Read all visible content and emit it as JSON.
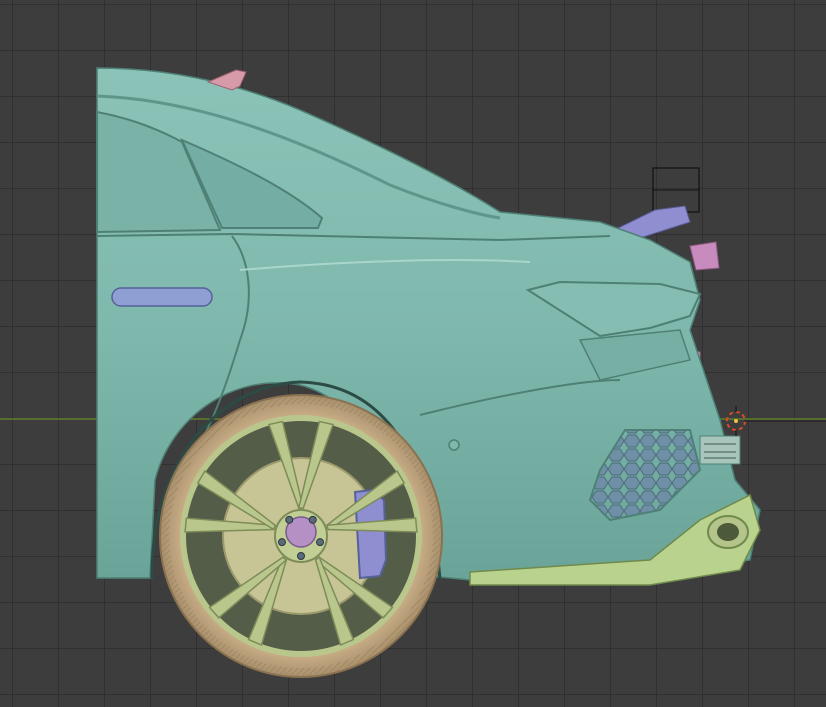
{
  "viewport": {
    "grid_color": "#303030",
    "background_color": "#3d3d3d",
    "x_axis_color": "#6b8f2a"
  },
  "colors": {
    "body": "#7fb8ad",
    "body_shadow": "#5f968c",
    "body_highlight": "#a9d6cc",
    "window": "#74ada3",
    "tire": "#c8ad86",
    "tire_dark": "#a8906c",
    "rim": "#b9c78d",
    "disc": "#c7c496",
    "hub": "#b490c4",
    "caliper": "#8f8ed0",
    "exhaust_tip": "#c88bbd",
    "antenna": "#d79aa8",
    "honeycomb": "#6f8fa6",
    "origin_red": "#d94a2a"
  },
  "icons": {
    "origin": "3d-cursor-icon",
    "selection": "selection-box-icon"
  }
}
